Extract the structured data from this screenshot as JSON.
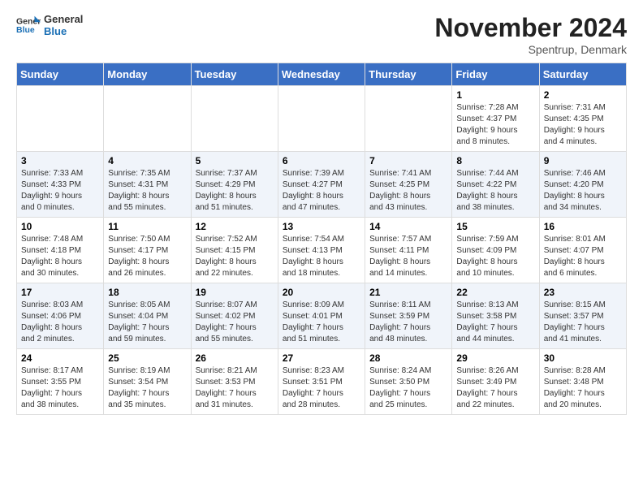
{
  "logo": {
    "line1": "General",
    "line2": "Blue"
  },
  "title": "November 2024",
  "subtitle": "Spentrup, Denmark",
  "days_of_week": [
    "Sunday",
    "Monday",
    "Tuesday",
    "Wednesday",
    "Thursday",
    "Friday",
    "Saturday"
  ],
  "weeks": [
    [
      {
        "day": "",
        "info": ""
      },
      {
        "day": "",
        "info": ""
      },
      {
        "day": "",
        "info": ""
      },
      {
        "day": "",
        "info": ""
      },
      {
        "day": "",
        "info": ""
      },
      {
        "day": "1",
        "info": "Sunrise: 7:28 AM\nSunset: 4:37 PM\nDaylight: 9 hours\nand 8 minutes."
      },
      {
        "day": "2",
        "info": "Sunrise: 7:31 AM\nSunset: 4:35 PM\nDaylight: 9 hours\nand 4 minutes."
      }
    ],
    [
      {
        "day": "3",
        "info": "Sunrise: 7:33 AM\nSunset: 4:33 PM\nDaylight: 9 hours\nand 0 minutes."
      },
      {
        "day": "4",
        "info": "Sunrise: 7:35 AM\nSunset: 4:31 PM\nDaylight: 8 hours\nand 55 minutes."
      },
      {
        "day": "5",
        "info": "Sunrise: 7:37 AM\nSunset: 4:29 PM\nDaylight: 8 hours\nand 51 minutes."
      },
      {
        "day": "6",
        "info": "Sunrise: 7:39 AM\nSunset: 4:27 PM\nDaylight: 8 hours\nand 47 minutes."
      },
      {
        "day": "7",
        "info": "Sunrise: 7:41 AM\nSunset: 4:25 PM\nDaylight: 8 hours\nand 43 minutes."
      },
      {
        "day": "8",
        "info": "Sunrise: 7:44 AM\nSunset: 4:22 PM\nDaylight: 8 hours\nand 38 minutes."
      },
      {
        "day": "9",
        "info": "Sunrise: 7:46 AM\nSunset: 4:20 PM\nDaylight: 8 hours\nand 34 minutes."
      }
    ],
    [
      {
        "day": "10",
        "info": "Sunrise: 7:48 AM\nSunset: 4:18 PM\nDaylight: 8 hours\nand 30 minutes."
      },
      {
        "day": "11",
        "info": "Sunrise: 7:50 AM\nSunset: 4:17 PM\nDaylight: 8 hours\nand 26 minutes."
      },
      {
        "day": "12",
        "info": "Sunrise: 7:52 AM\nSunset: 4:15 PM\nDaylight: 8 hours\nand 22 minutes."
      },
      {
        "day": "13",
        "info": "Sunrise: 7:54 AM\nSunset: 4:13 PM\nDaylight: 8 hours\nand 18 minutes."
      },
      {
        "day": "14",
        "info": "Sunrise: 7:57 AM\nSunset: 4:11 PM\nDaylight: 8 hours\nand 14 minutes."
      },
      {
        "day": "15",
        "info": "Sunrise: 7:59 AM\nSunset: 4:09 PM\nDaylight: 8 hours\nand 10 minutes."
      },
      {
        "day": "16",
        "info": "Sunrise: 8:01 AM\nSunset: 4:07 PM\nDaylight: 8 hours\nand 6 minutes."
      }
    ],
    [
      {
        "day": "17",
        "info": "Sunrise: 8:03 AM\nSunset: 4:06 PM\nDaylight: 8 hours\nand 2 minutes."
      },
      {
        "day": "18",
        "info": "Sunrise: 8:05 AM\nSunset: 4:04 PM\nDaylight: 7 hours\nand 59 minutes."
      },
      {
        "day": "19",
        "info": "Sunrise: 8:07 AM\nSunset: 4:02 PM\nDaylight: 7 hours\nand 55 minutes."
      },
      {
        "day": "20",
        "info": "Sunrise: 8:09 AM\nSunset: 4:01 PM\nDaylight: 7 hours\nand 51 minutes."
      },
      {
        "day": "21",
        "info": "Sunrise: 8:11 AM\nSunset: 3:59 PM\nDaylight: 7 hours\nand 48 minutes."
      },
      {
        "day": "22",
        "info": "Sunrise: 8:13 AM\nSunset: 3:58 PM\nDaylight: 7 hours\nand 44 minutes."
      },
      {
        "day": "23",
        "info": "Sunrise: 8:15 AM\nSunset: 3:57 PM\nDaylight: 7 hours\nand 41 minutes."
      }
    ],
    [
      {
        "day": "24",
        "info": "Sunrise: 8:17 AM\nSunset: 3:55 PM\nDaylight: 7 hours\nand 38 minutes."
      },
      {
        "day": "25",
        "info": "Sunrise: 8:19 AM\nSunset: 3:54 PM\nDaylight: 7 hours\nand 35 minutes."
      },
      {
        "day": "26",
        "info": "Sunrise: 8:21 AM\nSunset: 3:53 PM\nDaylight: 7 hours\nand 31 minutes."
      },
      {
        "day": "27",
        "info": "Sunrise: 8:23 AM\nSunset: 3:51 PM\nDaylight: 7 hours\nand 28 minutes."
      },
      {
        "day": "28",
        "info": "Sunrise: 8:24 AM\nSunset: 3:50 PM\nDaylight: 7 hours\nand 25 minutes."
      },
      {
        "day": "29",
        "info": "Sunrise: 8:26 AM\nSunset: 3:49 PM\nDaylight: 7 hours\nand 22 minutes."
      },
      {
        "day": "30",
        "info": "Sunrise: 8:28 AM\nSunset: 3:48 PM\nDaylight: 7 hours\nand 20 minutes."
      }
    ]
  ]
}
